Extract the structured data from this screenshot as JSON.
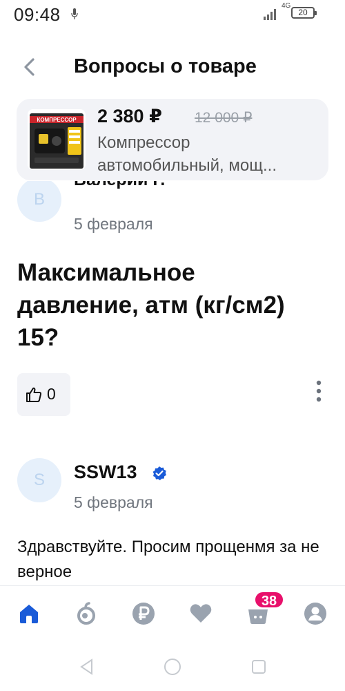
{
  "status_bar": {
    "time": "09:48",
    "network": "4G",
    "battery": "20"
  },
  "header": {
    "title": "Вопросы о товаре"
  },
  "product": {
    "price": "2 380 ₽",
    "old_price": "12 000 ₽",
    "name": "Компрессор автомобильный, мощ...",
    "thumb_label": "КОМПРЕССОР"
  },
  "question": {
    "author_initial": "В",
    "author_name_partial": "Валерий Г.",
    "date": "5 февраля",
    "text": "Максимальное давление, атм (кг/см2) 15?",
    "likes": "0"
  },
  "answer": {
    "author_initial": "S",
    "author_name": "SSW13",
    "date": "5 февраля",
    "text": "Здравствуйте. Просим прощенмя за не верное"
  },
  "bottom_nav": {
    "cart_badge": "38",
    "accent_color": "#1a5bd8",
    "icon_color": "#9aa3af"
  },
  "icons": [
    "back-icon",
    "home-icon",
    "catalog-icon",
    "ruble-icon",
    "heart-icon",
    "cart-icon",
    "profile-icon",
    "thumbs-up-icon",
    "more-vertical-icon",
    "verified-icon"
  ]
}
